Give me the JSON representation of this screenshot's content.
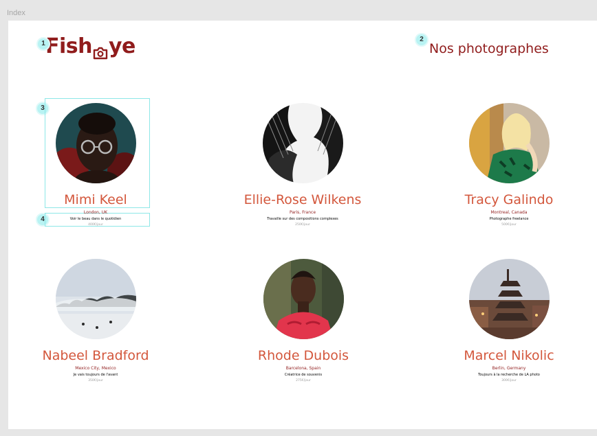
{
  "canvas": {
    "label": "Index"
  },
  "header": {
    "logo_text_before": "Fish",
    "logo_text_after": "ye",
    "logo_icon": "camera-icon",
    "heading": "Nos photographes"
  },
  "annotations": [
    "1",
    "2",
    "3",
    "4"
  ],
  "colors": {
    "brand": "#901C1C",
    "name": "#D3573C",
    "annotation": "#8DE7E7"
  },
  "photographers": [
    {
      "name": "Mimi Keel",
      "location": "London, UK",
      "tagline": "Voir le beau dans le quotidien",
      "price": "400€/jour"
    },
    {
      "name": "Ellie-Rose Wilkens",
      "location": "Paris, France",
      "tagline": "Travaille sur des compositions complexes",
      "price": "250€/jour"
    },
    {
      "name": "Tracy Galindo",
      "location": "Montreal, Canada",
      "tagline": "Photographe freelance",
      "price": "500€/jour"
    },
    {
      "name": "Nabeel Bradford",
      "location": "Mexico City, Mexico",
      "tagline": "Je vais toujours de l'avant",
      "price": "350€/jour"
    },
    {
      "name": "Rhode Dubois",
      "location": "Barcelona, Spain",
      "tagline": "Créatrice de souvenis",
      "price": "275€/jour"
    },
    {
      "name": "Marcel Nikolic",
      "location": "Berlin, Germany",
      "tagline": "Toujours à la recherche de LA photo",
      "price": "300€/jour"
    }
  ]
}
